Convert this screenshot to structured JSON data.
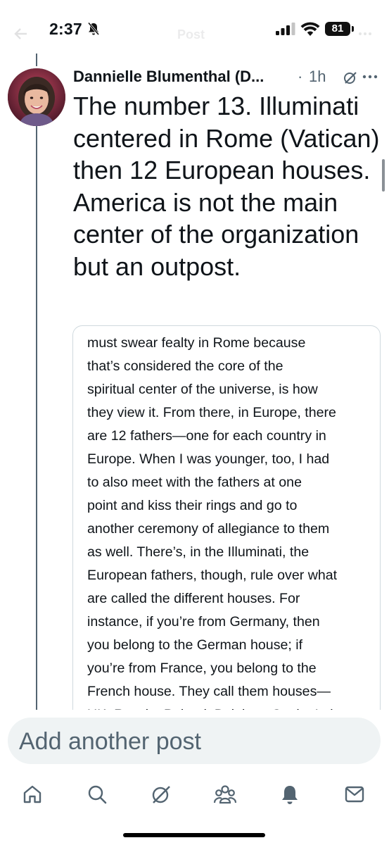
{
  "status_bar": {
    "time": "2:37",
    "battery": "81"
  },
  "header": {
    "title": "Post"
  },
  "post": {
    "author": "Dannielle Blumenthal (D...",
    "separator": "·",
    "time_ago": "1h",
    "text": "The number 13. Illuminati centered in Rome (Vatican) then 12 European houses. America is not the main center of the organization but an outpost.",
    "quote_lines": [
      "must swear fealty in Rome because",
      "that’s considered the core of the",
      "spiritual center of the universe, is how",
      "they view it. From there, in Europe, there",
      "are 12 fathers—one for each country in",
      "Europe. When I was younger, too, I had",
      "to also meet with the fathers at one",
      "point and kiss their rings and go to",
      "another ceremony of allegiance to them",
      "as well. There’s, in the Illuminati, the",
      "European fathers, though, rule over what",
      "are called the different houses. For",
      "instance, if you’re from Germany, then",
      "you belong to the German house; if",
      "you’re from France, you belong to the",
      "French house. They call them houses—",
      "UK, Russia, Poland, Belgium, Spain, Italy"
    ]
  },
  "compose": {
    "placeholder": "Add another post"
  },
  "nav": {
    "items": [
      {
        "icon": "home-icon"
      },
      {
        "icon": "search-icon"
      },
      {
        "icon": "grok-icon"
      },
      {
        "icon": "communities-icon"
      },
      {
        "icon": "notifications-icon"
      },
      {
        "icon": "messages-icon"
      }
    ]
  },
  "colors": {
    "text": "#0f1419",
    "secondary": "#536471",
    "border": "#cfd9de",
    "compose_bg": "#eff3f4"
  }
}
